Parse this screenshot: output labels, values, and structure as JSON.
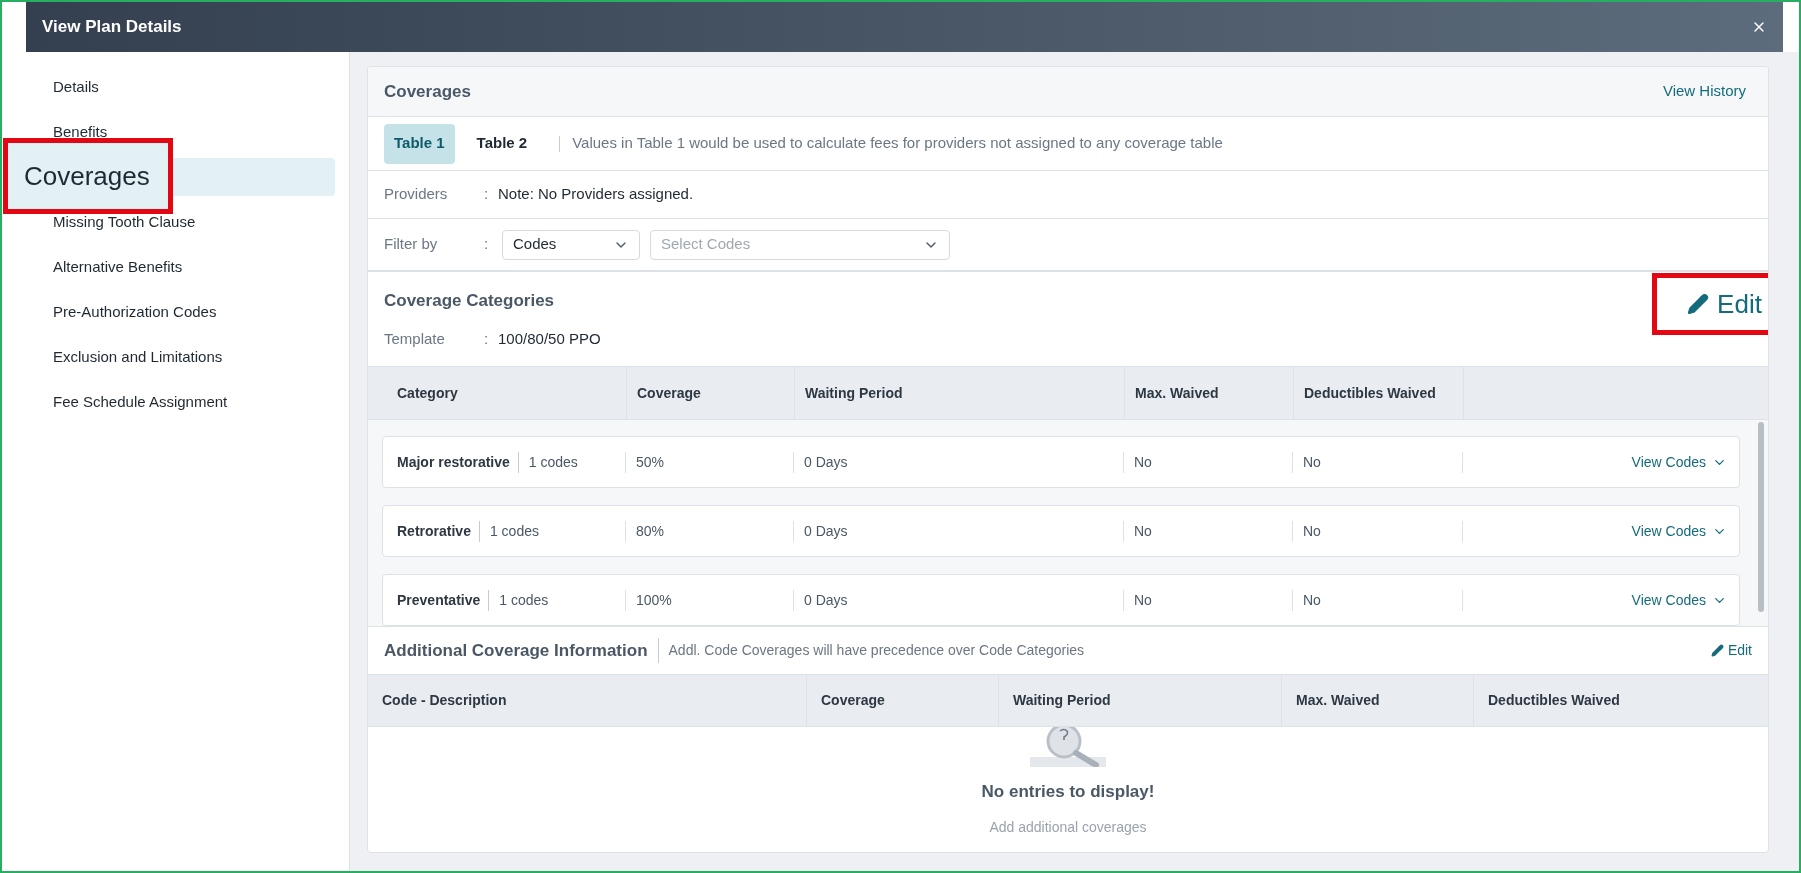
{
  "window": {
    "title": "View Plan Details"
  },
  "sidebar": {
    "items": [
      {
        "label": "Details",
        "selected": false,
        "callout": false
      },
      {
        "label": "Benefits",
        "selected": false,
        "callout": false
      },
      {
        "label": "Coverages",
        "selected": true,
        "callout": true
      },
      {
        "label": "Missing Tooth Clause",
        "selected": false,
        "callout": false
      },
      {
        "label": "Alternative Benefits",
        "selected": false,
        "callout": false
      },
      {
        "label": "Pre-Authorization Codes",
        "selected": false,
        "callout": false
      },
      {
        "label": "Exclusion and Limitations",
        "selected": false,
        "callout": false
      },
      {
        "label": "Fee Schedule Assignment",
        "selected": false,
        "callout": false
      }
    ]
  },
  "coverages": {
    "title": "Coverages",
    "view_history": "View History",
    "tabs": [
      {
        "label": "Table 1",
        "selected": true
      },
      {
        "label": "Table 2",
        "selected": false
      }
    ],
    "tabs_note": "Values in Table 1 would be used to calculate fees for providers not assigned to any coverage table",
    "providers": {
      "label": "Providers",
      "colon": ":",
      "value": "Note: No Providers assigned."
    },
    "filter": {
      "label": "Filter by",
      "colon": ":",
      "type_select": {
        "value": "Codes"
      },
      "codes_select": {
        "placeholder": "Select Codes"
      }
    }
  },
  "coverage_categories": {
    "title": "Coverage Categories",
    "edit": {
      "label": "Edit",
      "callout": true
    },
    "template": {
      "label": "Template",
      "colon": ":",
      "value": "100/80/50 PPO"
    },
    "columns": [
      "Category",
      "Coverage",
      "Waiting Period",
      "Max. Waived",
      "Deductibles Waived"
    ],
    "rows": [
      {
        "category": "Major restorative",
        "codes": "1 codes",
        "coverage": "50%",
        "waiting_period": "0 Days",
        "max_waived": "No",
        "deductibles_waived": "No",
        "action": "View Codes"
      },
      {
        "category": "Retrorative",
        "codes": "1 codes",
        "coverage": "80%",
        "waiting_period": "0 Days",
        "max_waived": "No",
        "deductibles_waived": "No",
        "action": "View Codes"
      },
      {
        "category": "Preventative",
        "codes": "1 codes",
        "coverage": "100%",
        "waiting_period": "0 Days",
        "max_waived": "No",
        "deductibles_waived": "No",
        "action": "View Codes"
      }
    ]
  },
  "additional_coverage": {
    "title": "Additional Coverage Information",
    "note": "Addl. Code Coverages will have precedence over Code Categories",
    "edit": {
      "label": "Edit",
      "callout": false
    },
    "columns": [
      "Code - Description",
      "Coverage",
      "Waiting Period",
      "Max. Waived",
      "Deductibles Waived"
    ],
    "empty": {
      "title": "No entries to display!",
      "subtitle": "Add additional coverages"
    }
  }
}
